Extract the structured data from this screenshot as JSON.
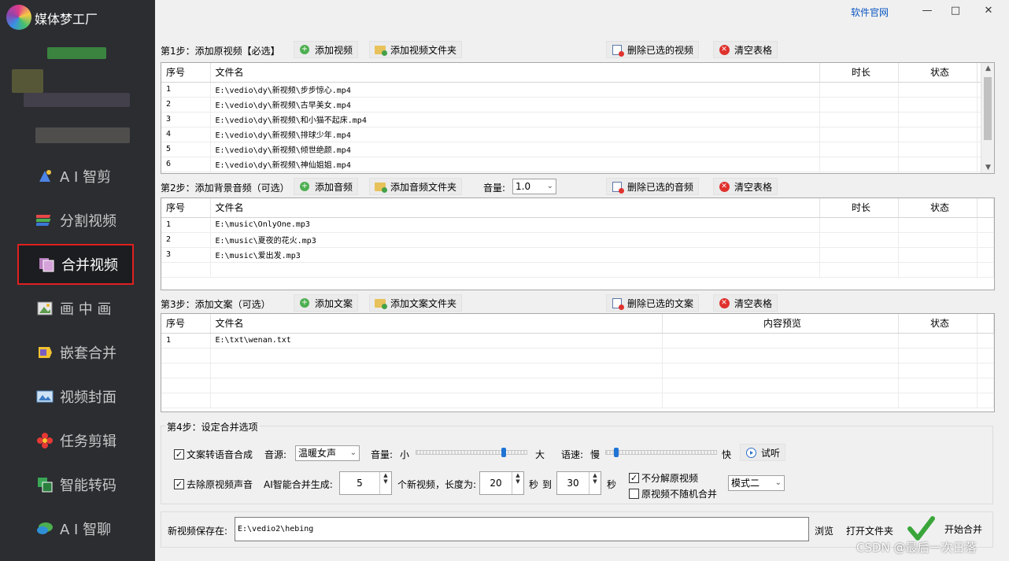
{
  "app": {
    "title": "媒体梦工厂"
  },
  "window": {
    "official_link": "软件官网",
    "minimize": "—",
    "maximize": "□",
    "close": "✕"
  },
  "sidebar": {
    "items": [
      {
        "label": "A I 智剪",
        "icon": "ai-clip-icon"
      },
      {
        "label": "分割视频",
        "icon": "split-video-icon"
      },
      {
        "label": "合并视频",
        "icon": "merge-video-icon",
        "active": true
      },
      {
        "label": "画 中 画",
        "icon": "picture-in-picture-icon"
      },
      {
        "label": "嵌套合并",
        "icon": "nested-merge-icon"
      },
      {
        "label": "视频封面",
        "icon": "video-cover-icon"
      },
      {
        "label": "任务剪辑",
        "icon": "task-edit-icon"
      },
      {
        "label": "智能转码",
        "icon": "smart-transcode-icon"
      },
      {
        "label": "A I 智聊",
        "icon": "ai-chat-icon"
      }
    ]
  },
  "step1": {
    "label": "第1步：添加原视频【必选】",
    "add_video": "添加视频",
    "add_folder": "添加视频文件夹",
    "delete_selected": "删除已选的视频",
    "clear_table": "清空表格",
    "columns": [
      "序号",
      "文件名",
      "时长",
      "状态"
    ],
    "rows": [
      [
        "1",
        "E:\\vedio\\dy\\新视频\\步步惊心.mp4",
        "",
        ""
      ],
      [
        "2",
        "E:\\vedio\\dy\\新视频\\古早美女.mp4",
        "",
        ""
      ],
      [
        "3",
        "E:\\vedio\\dy\\新视频\\和小猫不起床.mp4",
        "",
        ""
      ],
      [
        "4",
        "E:\\vedio\\dy\\新视频\\排球少年.mp4",
        "",
        ""
      ],
      [
        "5",
        "E:\\vedio\\dy\\新视频\\倾世绝颜.mp4",
        "",
        ""
      ],
      [
        "6",
        "E:\\vedio\\dy\\新视频\\神仙姐姐.mp4",
        "",
        ""
      ]
    ]
  },
  "step2": {
    "label": "第2步：添加背景音频（可选）",
    "add_audio": "添加音频",
    "add_folder": "添加音频文件夹",
    "volume_label": "音量:",
    "volume_value": "1.0",
    "delete_selected": "删除已选的音频",
    "clear_table": "清空表格",
    "columns": [
      "序号",
      "文件名",
      "时长",
      "状态"
    ],
    "rows": [
      [
        "1",
        "E:\\music\\OnlyOne.mp3",
        "",
        ""
      ],
      [
        "2",
        "E:\\music\\夏夜的花火.mp3",
        "",
        ""
      ],
      [
        "3",
        "E:\\music\\爱出发.mp3",
        "",
        ""
      ]
    ]
  },
  "step3": {
    "label": "第3步：添加文案（可选）",
    "add_text": "添加文案",
    "add_folder": "添加文案文件夹",
    "delete_selected": "删除已选的文案",
    "clear_table": "清空表格",
    "columns": [
      "序号",
      "文件名",
      "内容预览",
      "状态"
    ],
    "rows": [
      [
        "1",
        "E:\\txt\\wenan.txt",
        "",
        ""
      ]
    ]
  },
  "step4": {
    "label": "第4步：设定合并选项",
    "tts": {
      "label": "文案转语音合成",
      "checked": true
    },
    "voice_label": "音源:",
    "voice_value": "温暖女声",
    "volume": {
      "label": "音量:",
      "min": "小",
      "max": "大",
      "level": 0.8
    },
    "speed": {
      "label": "语速:",
      "min": "慢",
      "max": "快",
      "level": 0.08
    },
    "preview": "试听",
    "remove_audio": {
      "label": "去除原视频声音",
      "checked": true
    },
    "ai_gen_label": "AI智能合并生成:",
    "count": "5",
    "count_suffix": "个新视频，长度为:",
    "len_min": "20",
    "sec1": "秒",
    "to": "到",
    "len_max": "30",
    "sec2": "秒",
    "no_split": {
      "label": "不分解原视频",
      "checked": true
    },
    "no_random": {
      "label": "原视频不随机合并",
      "checked": false
    },
    "mode": "模式二"
  },
  "output": {
    "label": "新视频保存在:",
    "path": "E:\\vedio2\\hebing",
    "browse": "浏览",
    "open_folder": "打开文件夹",
    "start": "开始合并"
  },
  "watermark": "CSDN @最后一次日落",
  "colors": {
    "sidebar_bg": "#2b2d31",
    "active_border": "#e02020",
    "link": "#0a56c2"
  }
}
